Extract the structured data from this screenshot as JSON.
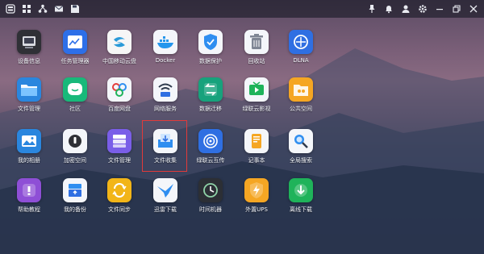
{
  "topbar": {
    "left_icons": [
      "dashboard-icon",
      "apps-grid-icon",
      "share-icon",
      "mail-icon",
      "save-icon"
    ],
    "right_icons": [
      "pin-icon",
      "notification-bell-icon",
      "user-icon",
      "settings-gear-icon",
      "minimize-icon",
      "restore-icon",
      "close-icon"
    ]
  },
  "apps": [
    {
      "label": "设备信息",
      "icon": "device-info-icon",
      "color": "#2f3036"
    },
    {
      "label": "任务管理器",
      "icon": "task-manager-icon",
      "color": "#2d6fe8"
    },
    {
      "label": "中国移动云盘",
      "icon": "mobile-cloud-disk-icon",
      "color": "#f6f6f6"
    },
    {
      "label": "Docker",
      "icon": "docker-icon",
      "color": "#f4f6fa"
    },
    {
      "label": "数据保护",
      "icon": "data-protection-icon",
      "color": "#f4f6fa"
    },
    {
      "label": "回收站",
      "icon": "recycle-bin-icon",
      "color": "#f4f6fa"
    },
    {
      "label": "DLNA",
      "icon": "dlna-icon",
      "color": "#2f6fe2"
    },
    {
      "label": "文件管理",
      "icon": "file-manager-icon",
      "color": "#2a86de"
    },
    {
      "label": "社区",
      "icon": "community-icon",
      "color": "#18b97a"
    },
    {
      "label": "百度网盘",
      "icon": "baidu-netdisk-icon",
      "color": "#f4f6fa"
    },
    {
      "label": "网络服务",
      "icon": "network-service-icon",
      "color": "#f4f6fa"
    },
    {
      "label": "数据迁移",
      "icon": "data-migration-icon",
      "color": "#17a27c"
    },
    {
      "label": "绿联云影视",
      "icon": "ugreen-video-icon",
      "color": "#f4f6fa"
    },
    {
      "label": "公共空间",
      "icon": "public-space-icon",
      "color": "#f5a623"
    },
    {
      "label": "我的相册",
      "icon": "my-album-icon",
      "color": "#2a86de"
    },
    {
      "label": "加密空间",
      "icon": "encrypted-space-icon",
      "color": "#f4f6fa"
    },
    {
      "label": "文件管理",
      "icon": "file-organize-icon",
      "color": "#7a5ee8"
    },
    {
      "label": "文件收集",
      "icon": "file-collection-icon",
      "color": "#f4f6fa"
    },
    {
      "label": "绿联云互传",
      "icon": "ugreen-transfer-icon",
      "color": "#2f6fe2"
    },
    {
      "label": "记事本",
      "icon": "notepad-icon",
      "color": "#f4f6fa"
    },
    {
      "label": "全局搜索",
      "icon": "global-search-icon",
      "color": "#f4f6fa"
    },
    {
      "label": "帮助教程",
      "icon": "help-tutorial-icon",
      "color": "#8e4fd6"
    },
    {
      "label": "我的备份",
      "icon": "my-backup-icon",
      "color": "#f4f6fa"
    },
    {
      "label": "文件同步",
      "icon": "file-sync-icon",
      "color": "#f2b518"
    },
    {
      "label": "迅雷下载",
      "icon": "thunder-download-icon",
      "color": "#f4f6fa"
    },
    {
      "label": "时间机器",
      "icon": "time-machine-icon",
      "color": "#2c2f35"
    },
    {
      "label": "外置UPS",
      "icon": "external-ups-icon",
      "color": "#f5a623"
    },
    {
      "label": "离线下载",
      "icon": "offline-download-icon",
      "color": "#1fb35a"
    }
  ]
}
